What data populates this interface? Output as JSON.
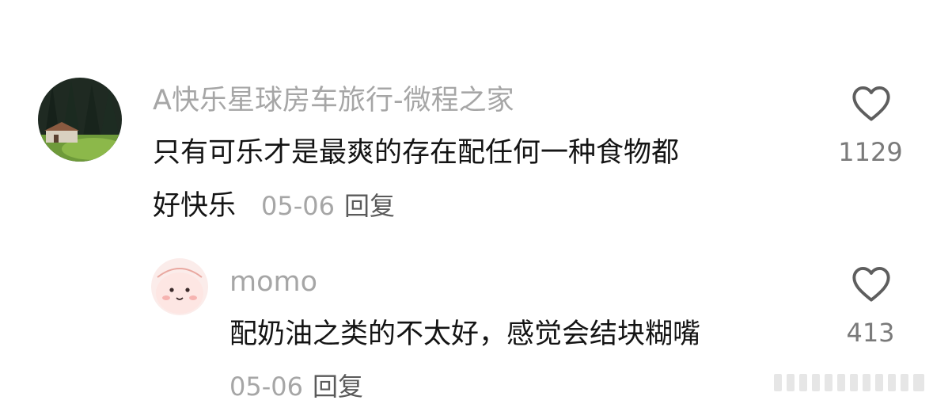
{
  "comments": [
    {
      "username": "A快乐星球房车旅行-微程之家",
      "text_line1": "只有可乐才是最爽的存在配任何一种食物都",
      "text_line2": "好快乐",
      "date": "05-06",
      "reply_label": "回复",
      "like_count": "1129",
      "avatar_icon": "forest-cabin-avatar"
    },
    {
      "username": "momo",
      "text_line1": "配奶油之类的不太好，感觉会结块糊嘴",
      "date": "05-06",
      "reply_label": "回复",
      "like_count": "413",
      "avatar_icon": "cute-character-avatar"
    }
  ],
  "icons": {
    "like": "heart-outline-icon"
  },
  "colors": {
    "username": "#a6a6a6",
    "text": "#141414",
    "count": "#7a7a7a",
    "icon": "#5e5e5e"
  }
}
